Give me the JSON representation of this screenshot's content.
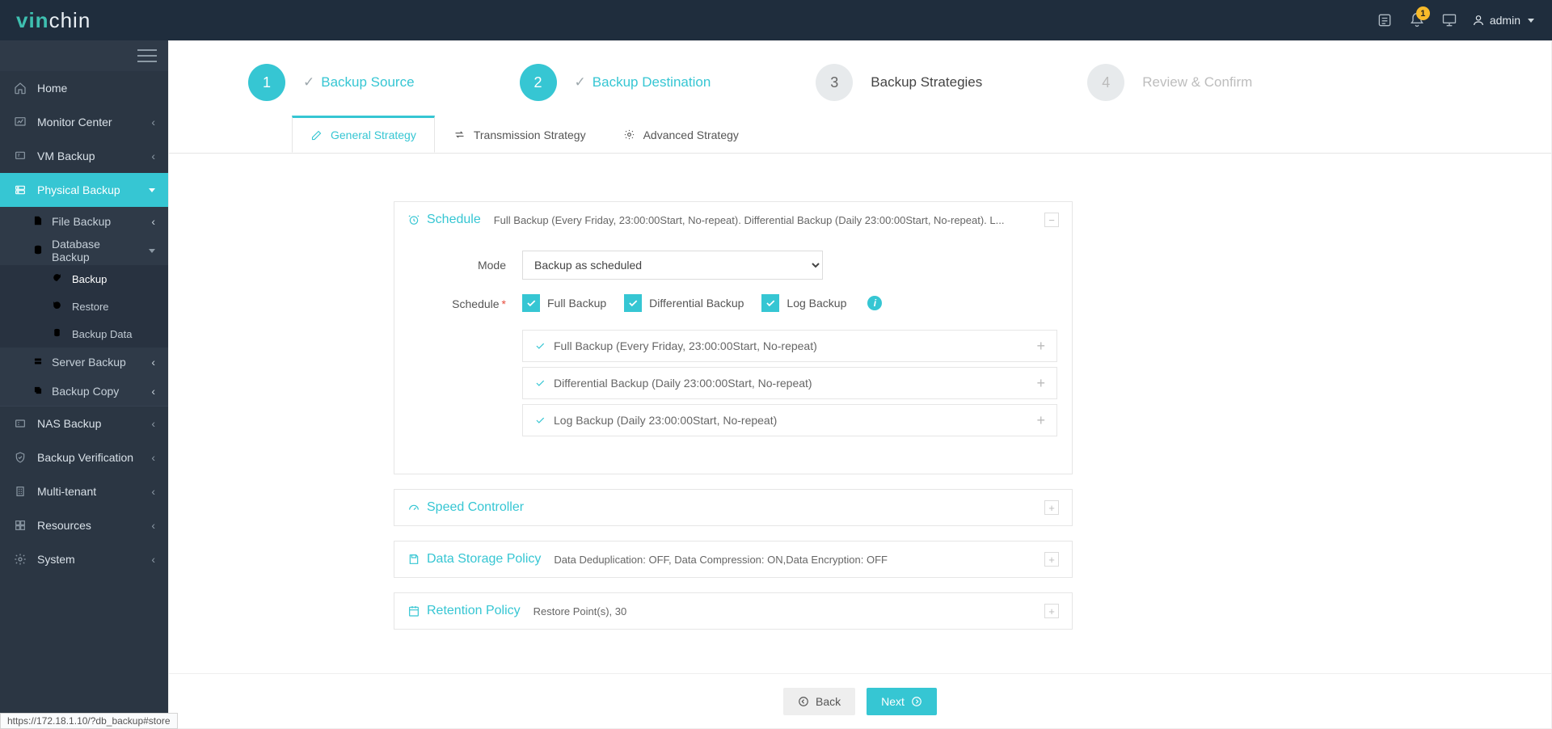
{
  "brand": {
    "prefix": "vin",
    "suffix": "chin"
  },
  "topbar": {
    "user": "admin",
    "notif_count": "1"
  },
  "sidebar": {
    "items": [
      {
        "label": "Home"
      },
      {
        "label": "Monitor Center"
      },
      {
        "label": "VM Backup"
      },
      {
        "label": "Physical Backup"
      },
      {
        "label": "NAS Backup"
      },
      {
        "label": "Backup Verification"
      },
      {
        "label": "Multi-tenant"
      },
      {
        "label": "Resources"
      },
      {
        "label": "System"
      }
    ],
    "physical_children": [
      {
        "label": "File Backup"
      },
      {
        "label": "Database Backup"
      },
      {
        "label": "Server Backup"
      },
      {
        "label": "Backup Copy"
      }
    ],
    "db_children": [
      {
        "label": "Backup"
      },
      {
        "label": "Restore"
      },
      {
        "label": "Backup Data"
      }
    ]
  },
  "wizard": {
    "steps": [
      {
        "n": "1",
        "label": "Backup Source"
      },
      {
        "n": "2",
        "label": "Backup Destination"
      },
      {
        "n": "3",
        "label": "Backup Strategies"
      },
      {
        "n": "4",
        "label": "Review & Confirm"
      }
    ]
  },
  "tabs": [
    {
      "label": "General Strategy"
    },
    {
      "label": "Transmission Strategy"
    },
    {
      "label": "Advanced Strategy"
    }
  ],
  "schedule_panel": {
    "title": "Schedule",
    "summary": "Full Backup (Every Friday, 23:00:00Start, No-repeat). Differential Backup (Daily 23:00:00Start, No-repeat). L...",
    "mode_label": "Mode",
    "mode_value": "Backup as scheduled",
    "schedule_label": "Schedule",
    "ckbx": {
      "full": "Full Backup",
      "diff": "Differential Backup",
      "log": "Log Backup"
    },
    "rows": [
      "Full Backup (Every Friday, 23:00:00Start, No-repeat)",
      "Differential Backup (Daily 23:00:00Start, No-repeat)",
      "Log Backup (Daily 23:00:00Start, No-repeat)"
    ]
  },
  "panels": {
    "speed": {
      "title": "Speed Controller",
      "summary": ""
    },
    "storage": {
      "title": "Data Storage Policy",
      "summary": "Data Deduplication: OFF, Data Compression: ON,Data Encryption: OFF"
    },
    "retention": {
      "title": "Retention Policy",
      "summary": "Restore Point(s), 30"
    }
  },
  "footer": {
    "back": "Back",
    "next": "Next"
  },
  "status_url": "https://172.18.1.10/?db_backup#store"
}
